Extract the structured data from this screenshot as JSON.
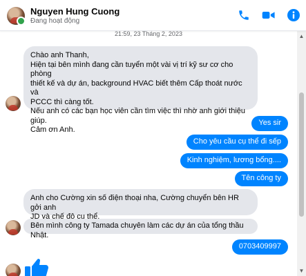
{
  "header": {
    "name": "Nguyen Hung Cuong",
    "status": "Đang hoạt động",
    "icons": [
      "phone-icon",
      "video-icon",
      "info-icon"
    ],
    "accent": "#0084ff"
  },
  "conversation": {
    "timestamp": "21:59, 23 Tháng 2, 2023",
    "messages": [
      {
        "from": "contact",
        "lines": [
          "Chào anh Thanh,",
          "Hiện tại bên mình đang cần tuyển một vài vị trí kỹ sư cơ cho phòng",
          "thiết kế và dự án, background HVAC biết thêm Cấp thoát nước và",
          "PCCC thì càng tốt.",
          "Nếu anh có các bạn học viên cần tìm việc thì nhờ anh giới thiệu giúp.",
          "Cảm ơn Anh."
        ]
      },
      {
        "from": "me",
        "text": "Yes sir"
      },
      {
        "from": "me",
        "text": "Cho yêu cầu cụ thể đi sếp"
      },
      {
        "from": "me",
        "text": "Kinh nghiệm, lương bổng...."
      },
      {
        "from": "me",
        "text": "Tên công ty"
      },
      {
        "from": "contact",
        "lines": [
          "Anh cho Cường xin số điện thoại nha, Cường chuyển bên HR gởi anh",
          "JD và chế độ cụ thể."
        ]
      },
      {
        "from": "contact",
        "lines": [
          "Bên mình công ty Tamada chuyên làm các dự án của tổng thầu Nhật."
        ]
      },
      {
        "from": "me",
        "text": "0703409997"
      },
      {
        "from": "me",
        "type": "like",
        "icon": "thumbs-up-icon"
      }
    ]
  },
  "colors": {
    "incoming_bubble": "#e4e6eb",
    "outgoing_bubble": "#0084ff",
    "online": "#31a24c"
  }
}
